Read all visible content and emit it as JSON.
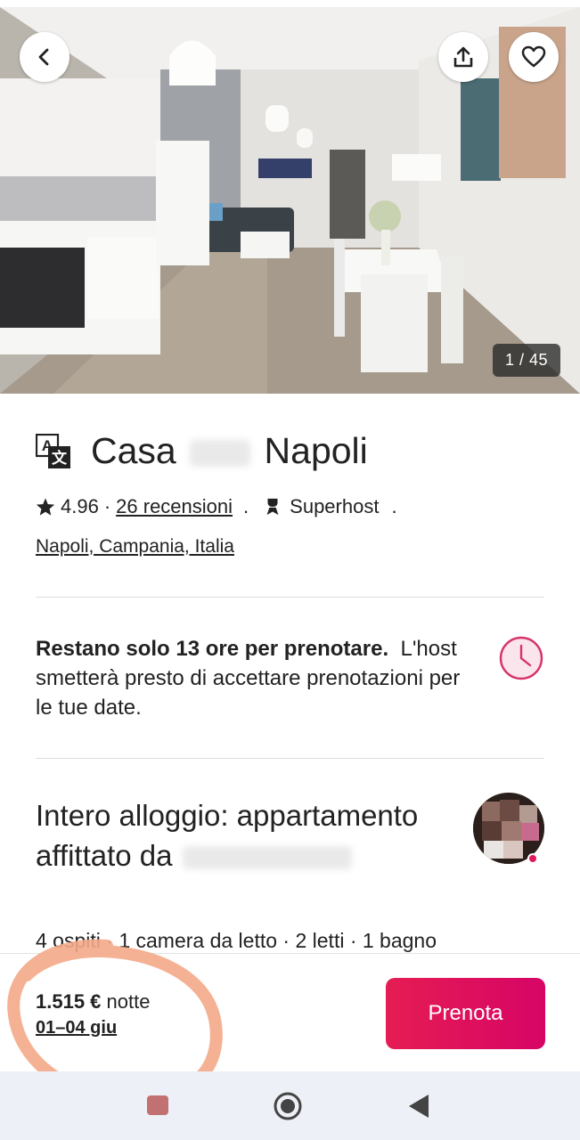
{
  "photo": {
    "counter": "1 / 45"
  },
  "header_buttons": {
    "back_icon": "chevron-left-icon",
    "share_icon": "share-icon",
    "favorite_icon": "heart-icon"
  },
  "listing": {
    "title_left": "Casa",
    "title_right": "Napoli",
    "rating": "4.96",
    "rating_sep": "·",
    "reviews": "26 recensioni",
    "dot": ".",
    "superhost": "Superhost",
    "dot2": ".",
    "location": "Napoli, Campania, Italia"
  },
  "notice": {
    "bold": "Restano solo 13 ore per prenotare.",
    "text": "L'host smetterà presto di accettare prenotazioni per le tue date."
  },
  "details": {
    "title": "Intero alloggio: appartamento affittato da",
    "amenities": "4 ospiti · 1 camera da letto · 2 letti · 1 bagno"
  },
  "booking": {
    "price": "1.515 €",
    "unit": "notte",
    "dates": "01–04 giu",
    "button": "Prenota"
  },
  "colors": {
    "brand": "#e01e5a",
    "annotation": "#f4a887"
  }
}
